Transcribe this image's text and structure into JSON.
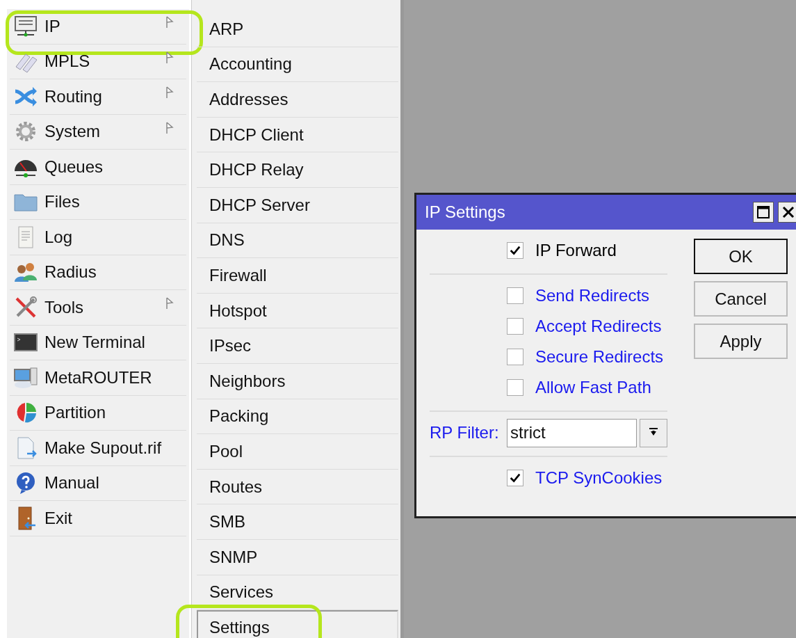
{
  "main_menu": [
    {
      "label": "IP",
      "has_submenu": true,
      "highlighted": true
    },
    {
      "label": "MPLS",
      "has_submenu": true,
      "highlighted": false
    },
    {
      "label": "Routing",
      "has_submenu": true,
      "highlighted": false
    },
    {
      "label": "System",
      "has_submenu": true,
      "highlighted": false
    },
    {
      "label": "Queues",
      "has_submenu": false,
      "highlighted": false
    },
    {
      "label": "Files",
      "has_submenu": false,
      "highlighted": false
    },
    {
      "label": "Log",
      "has_submenu": false,
      "highlighted": false
    },
    {
      "label": "Radius",
      "has_submenu": false,
      "highlighted": false
    },
    {
      "label": "Tools",
      "has_submenu": true,
      "highlighted": false
    },
    {
      "label": "New Terminal",
      "has_submenu": false,
      "highlighted": false
    },
    {
      "label": "MetaROUTER",
      "has_submenu": false,
      "highlighted": false
    },
    {
      "label": "Partition",
      "has_submenu": false,
      "highlighted": false
    },
    {
      "label": "Make Supout.rif",
      "has_submenu": false,
      "highlighted": false
    },
    {
      "label": "Manual",
      "has_submenu": false,
      "highlighted": false
    },
    {
      "label": "Exit",
      "has_submenu": false,
      "highlighted": false
    }
  ],
  "submenu": [
    {
      "label": "ARP",
      "selected": false,
      "highlighted": false
    },
    {
      "label": "Accounting",
      "selected": false,
      "highlighted": false
    },
    {
      "label": "Addresses",
      "selected": false,
      "highlighted": false
    },
    {
      "label": "DHCP Client",
      "selected": false,
      "highlighted": false
    },
    {
      "label": "DHCP Relay",
      "selected": false,
      "highlighted": false
    },
    {
      "label": "DHCP Server",
      "selected": false,
      "highlighted": false
    },
    {
      "label": "DNS",
      "selected": false,
      "highlighted": false
    },
    {
      "label": "Firewall",
      "selected": false,
      "highlighted": false
    },
    {
      "label": "Hotspot",
      "selected": false,
      "highlighted": false
    },
    {
      "label": "IPsec",
      "selected": false,
      "highlighted": false
    },
    {
      "label": "Neighbors",
      "selected": false,
      "highlighted": false
    },
    {
      "label": "Packing",
      "selected": false,
      "highlighted": false
    },
    {
      "label": "Pool",
      "selected": false,
      "highlighted": false
    },
    {
      "label": "Routes",
      "selected": false,
      "highlighted": false
    },
    {
      "label": "SMB",
      "selected": false,
      "highlighted": false
    },
    {
      "label": "SNMP",
      "selected": false,
      "highlighted": false
    },
    {
      "label": "Services",
      "selected": false,
      "highlighted": false
    },
    {
      "label": "Settings",
      "selected": true,
      "highlighted": true
    }
  ],
  "dialog": {
    "title": "IP Settings",
    "sections": [
      [
        {
          "kind": "checkbox",
          "label": "IP Forward",
          "checked": true,
          "color": "#000000"
        }
      ],
      [
        {
          "kind": "checkbox",
          "label": "Send Redirects",
          "checked": false,
          "color": "#1a1aee"
        },
        {
          "kind": "checkbox",
          "label": "Accept Redirects",
          "checked": false,
          "color": "#1a1aee"
        },
        {
          "kind": "checkbox",
          "label": "Secure Redirects",
          "checked": false,
          "color": "#1a1aee"
        },
        {
          "kind": "checkbox",
          "label": "Allow Fast Path",
          "checked": false,
          "color": "#1a1aee"
        }
      ],
      [
        {
          "kind": "select",
          "label": "RP Filter:",
          "value": "strict",
          "color": "#1a1aee"
        }
      ],
      [
        {
          "kind": "checkbox",
          "label": "TCP SynCookies",
          "checked": true,
          "color": "#1a1aee"
        }
      ]
    ],
    "buttons": [
      {
        "label": "OK",
        "default": true
      },
      {
        "label": "Cancel",
        "default": false
      },
      {
        "label": "Apply",
        "default": false
      }
    ]
  }
}
